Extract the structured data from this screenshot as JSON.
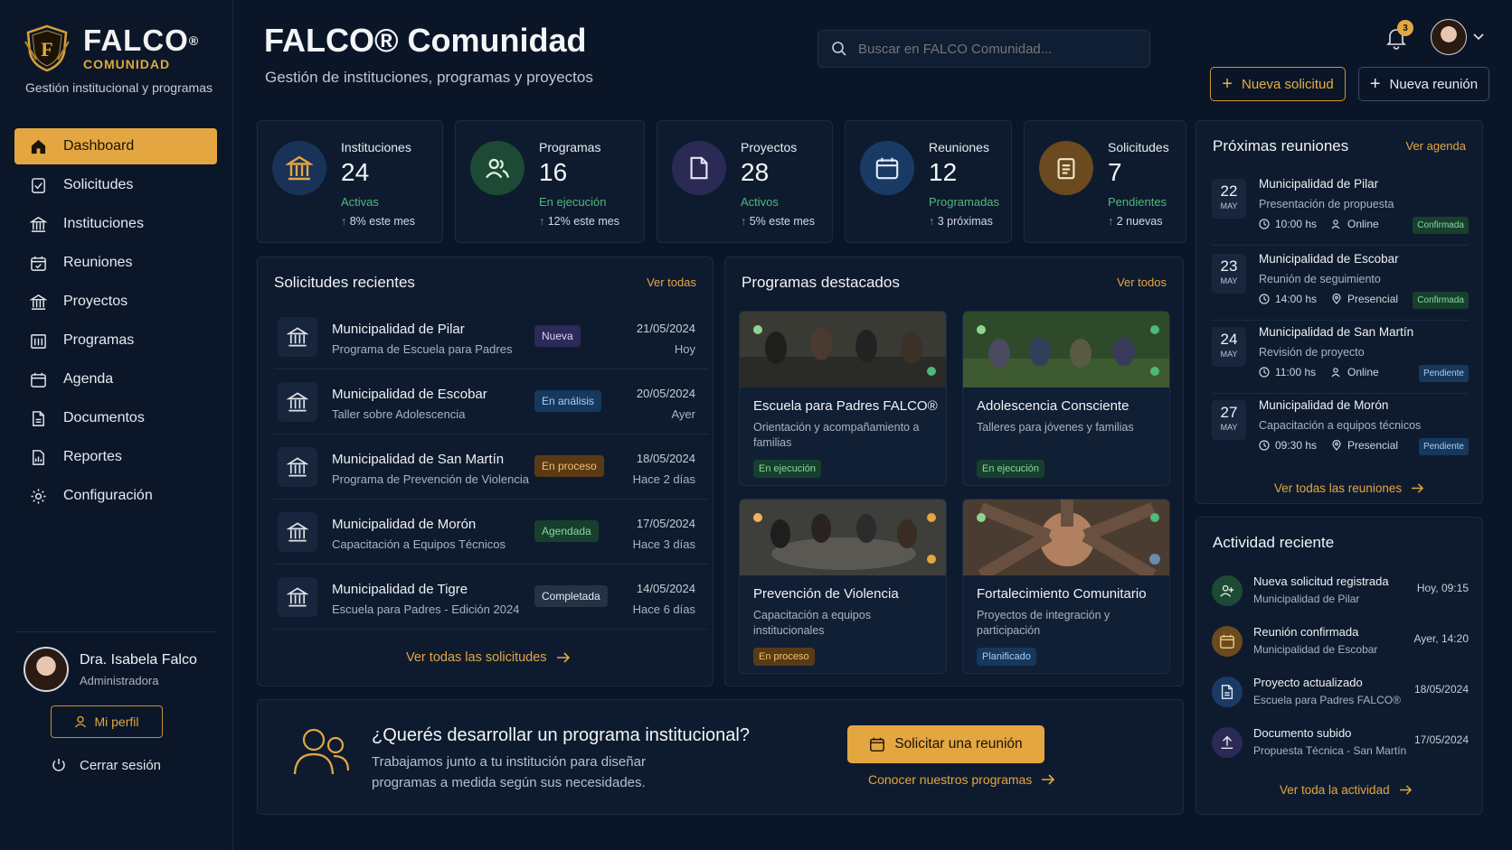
{
  "sidebar": {
    "brand": "FALCO",
    "brand_reg": "®",
    "brand_sub": "COMUNIDAD",
    "tagline": "Gestión institucional y programas",
    "items": [
      {
        "label": "Dashboard",
        "icon": "home-icon"
      },
      {
        "label": "Solicitudes",
        "icon": "request-icon"
      },
      {
        "label": "Instituciones",
        "icon": "institution-icon"
      },
      {
        "label": "Reuniones",
        "icon": "meeting-icon"
      },
      {
        "label": "Proyectos",
        "icon": "project-icon"
      },
      {
        "label": "Programas",
        "icon": "program-icon"
      },
      {
        "label": "Agenda",
        "icon": "calendar-icon"
      },
      {
        "label": "Documentos",
        "icon": "document-icon"
      },
      {
        "label": "Reportes",
        "icon": "report-icon"
      },
      {
        "label": "Configuración",
        "icon": "gear-icon"
      }
    ],
    "user": {
      "name": "Dra. Isabela Falco",
      "role": "Administradora"
    },
    "profile_label": "Mi perfil",
    "logout_label": "Cerrar sesión"
  },
  "header": {
    "title": "FALCO® Comunidad",
    "subtitle": "Gestión de instituciones, programas y proyectos",
    "search_placeholder": "Buscar en FALCO Comunidad...",
    "notifications": "3",
    "new_request": "Nueva solicitud",
    "new_meeting": "Nueva reunión"
  },
  "stats": [
    {
      "label": "Instituciones",
      "value": "24",
      "status": "Activas",
      "trend": "8% este mes",
      "trend_arrow": "↑"
    },
    {
      "label": "Programas",
      "value": "16",
      "status": "En ejecución",
      "trend": "12% este mes",
      "trend_arrow": "↑"
    },
    {
      "label": "Proyectos",
      "value": "28",
      "status": "Activos",
      "trend": "5% este mes",
      "trend_arrow": "↑"
    },
    {
      "label": "Reuniones",
      "value": "12",
      "status": "Programadas",
      "trend": "3 próximas",
      "trend_arrow": "↑"
    },
    {
      "label": "Solicitudes",
      "value": "7",
      "status": "Pendientes",
      "trend": "2 nuevas",
      "trend_arrow": "↑"
    }
  ],
  "requests": {
    "title": "Solicitudes recientes",
    "link": "Ver todas",
    "rows": [
      {
        "name": "Municipalidad de Pilar",
        "sub": "Programa de Escuela para Padres",
        "status": "Nueva",
        "date": "21/05/2024",
        "rel": "Hoy"
      },
      {
        "name": "Municipalidad de Escobar",
        "sub": "Taller sobre Adolescencia",
        "status": "En análisis",
        "date": "20/05/2024",
        "rel": "Ayer"
      },
      {
        "name": "Municipalidad de San Martín",
        "sub": "Programa de Prevención de Violencia",
        "status": "En proceso",
        "date": "18/05/2024",
        "rel": "Hace 2 días"
      },
      {
        "name": "Municipalidad de Morón",
        "sub": "Capacitación a Equipos Técnicos",
        "status": "Agendada",
        "date": "17/05/2024",
        "rel": "Hace 3 días"
      },
      {
        "name": "Municipalidad de Tigre",
        "sub": "Escuela para Padres - Edición 2024",
        "status": "Completada",
        "date": "14/05/2024",
        "rel": "Hace 6 días"
      }
    ],
    "footer": "Ver todas las solicitudes"
  },
  "programs": {
    "title": "Programas destacados",
    "link": "Ver todos",
    "items": [
      {
        "title": "Escuela para Padres FALCO®",
        "desc": "Orientación y acompañamiento a familias",
        "status": "En ejecución"
      },
      {
        "title": "Adolescencia Consciente",
        "desc": "Talleres para jóvenes y familias",
        "status": "En ejecución"
      },
      {
        "title": "Prevención de Violencia",
        "desc": "Capacitación a equipos institucionales",
        "status": "En proceso"
      },
      {
        "title": "Fortalecimiento Comunitario",
        "desc": "Proyectos de integración y participación",
        "status": "Planificado"
      }
    ]
  },
  "meetings": {
    "title": "Próximas reuniones",
    "link": "Ver agenda",
    "items": [
      {
        "day": "22",
        "month": "MAY",
        "name": "Municipalidad de Pilar",
        "sub": "Presentación de propuesta",
        "time": "10:00 hs",
        "mode": "Online",
        "status": "Confirmada"
      },
      {
        "day": "23",
        "month": "MAY",
        "name": "Municipalidad de Escobar",
        "sub": "Reunión de seguimiento",
        "time": "14:00 hs",
        "mode": "Presencial",
        "status": "Confirmada"
      },
      {
        "day": "24",
        "month": "MAY",
        "name": "Municipalidad de San Martín",
        "sub": "Revisión de proyecto",
        "time": "11:00 hs",
        "mode": "Online",
        "status": "Pendiente"
      },
      {
        "day": "27",
        "month": "MAY",
        "name": "Municipalidad de Morón",
        "sub": "Capacitación a equipos técnicos",
        "time": "09:30 hs",
        "mode": "Presencial",
        "status": "Pendiente"
      }
    ],
    "footer": "Ver todas las reuniones"
  },
  "activity": {
    "title": "Actividad reciente",
    "items": [
      {
        "title": "Nueva solicitud registrada",
        "sub": "Municipalidad de Pilar",
        "date": "Hoy, 09:15"
      },
      {
        "title": "Reunión confirmada",
        "sub": "Municipalidad de Escobar",
        "date": "Ayer, 14:20"
      },
      {
        "title": "Proyecto actualizado",
        "sub": "Escuela para Padres FALCO®",
        "date": "18/05/2024"
      },
      {
        "title": "Documento subido",
        "sub": "Propuesta Técnica - San Martín",
        "date": "17/05/2024"
      }
    ],
    "footer": "Ver toda la actividad"
  },
  "cta": {
    "title": "¿Querés desarrollar un programa institucional?",
    "desc": "Trabajamos junto a tu institución para diseñar programas a medida según sus necesidades.",
    "button": "Solicitar una reunión",
    "link": "Conocer nuestros programas"
  },
  "colors": {
    "accent": "#e4a640",
    "background": "#0a1628",
    "card": "#0e1b2f"
  }
}
